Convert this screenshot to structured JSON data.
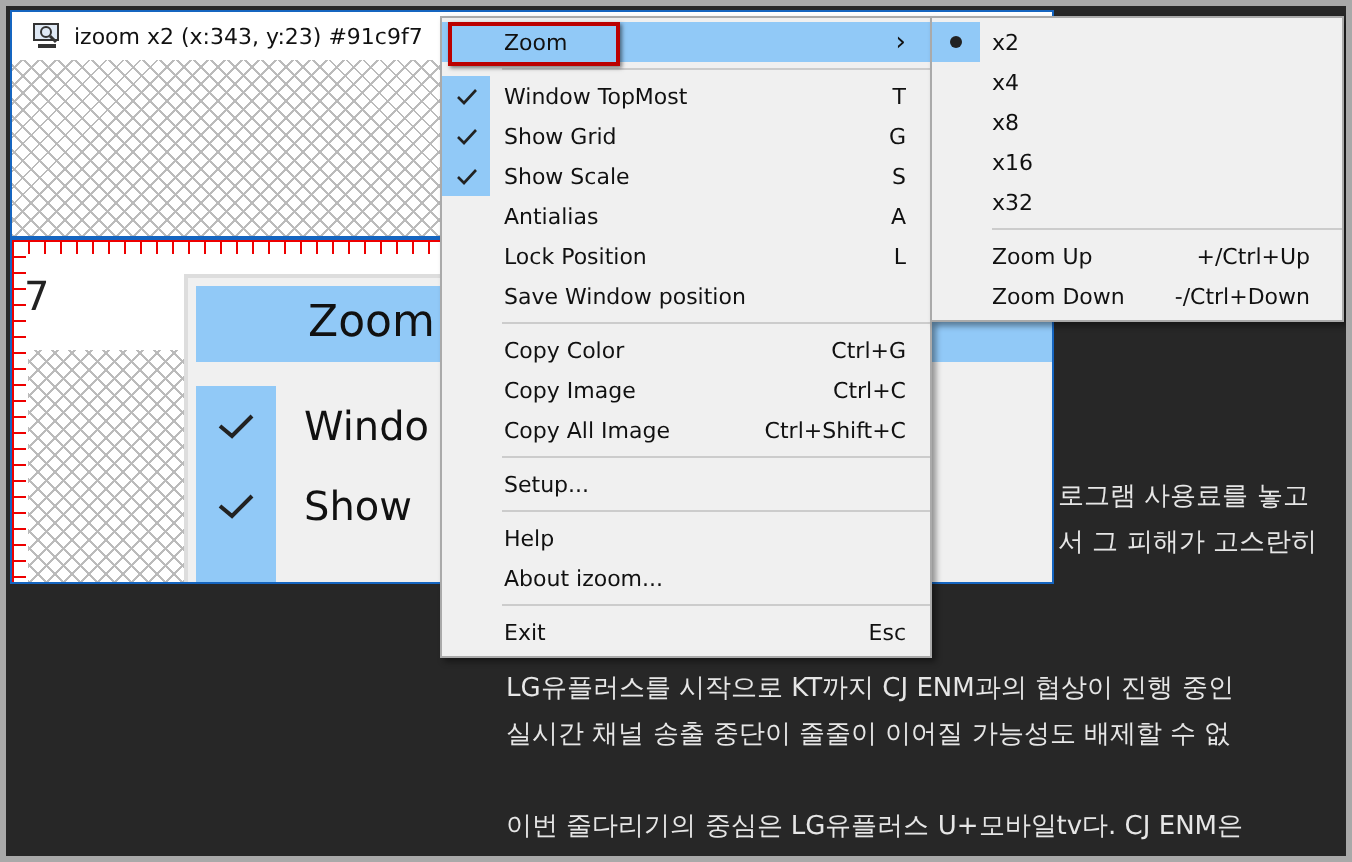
{
  "izoom_window": {
    "title": "izoom x2 (x:343, y:23) #91c9f7",
    "magnified_view": {
      "ruler_label": "7",
      "menu_header": "Zoom",
      "items": [
        {
          "label": "Windo",
          "checked": true
        },
        {
          "label": "Show",
          "checked": true
        }
      ]
    }
  },
  "article": {
    "lines_top": [
      "로그램 사용료를 놓고",
      "서 그 피해가 고스란히"
    ],
    "lines_bottom": [
      "LG유플러스를 시작으로 KT까지 CJ ENM과의 협상이 진행 중인",
      "실시간 채널 송출 중단이 줄줄이 이어질 가능성도 배제할 수 없"
    ],
    "paragraph_2": "이번 줄다리기의 중심은 LG유플러스 U+모바일tv다. CJ ENM은"
  },
  "context_menu": {
    "groups": [
      [
        {
          "kind": "submenu",
          "label": "Zoom",
          "arrow": "›",
          "selected": true,
          "annotated": true,
          "checked": false
        }
      ],
      [
        {
          "kind": "item",
          "label": "Window TopMost",
          "shortcut": "T",
          "checked": true,
          "selected": false,
          "annotated": false
        },
        {
          "kind": "item",
          "label": "Show Grid",
          "shortcut": "G",
          "checked": true,
          "selected": false,
          "annotated": false
        },
        {
          "kind": "item",
          "label": "Show Scale",
          "shortcut": "S",
          "checked": true,
          "selected": false,
          "annotated": false
        },
        {
          "kind": "item",
          "label": "Antialias",
          "shortcut": "A",
          "checked": false,
          "selected": false,
          "annotated": false
        },
        {
          "kind": "item",
          "label": "Lock Position",
          "shortcut": "L",
          "checked": false,
          "selected": false,
          "annotated": false
        },
        {
          "kind": "item",
          "label": "Save Window position",
          "checked": false,
          "selected": false,
          "annotated": false
        }
      ],
      [
        {
          "kind": "item",
          "label": "Copy Color",
          "shortcut": "Ctrl+G",
          "checked": false,
          "selected": false,
          "annotated": false
        },
        {
          "kind": "item",
          "label": "Copy Image",
          "shortcut": "Ctrl+C",
          "checked": false,
          "selected": false,
          "annotated": false
        },
        {
          "kind": "item",
          "label": "Copy All Image",
          "shortcut": "Ctrl+Shift+C",
          "checked": false,
          "selected": false,
          "annotated": false
        }
      ],
      [
        {
          "kind": "item",
          "label": "Setup...",
          "checked": false,
          "selected": false,
          "annotated": false
        }
      ],
      [
        {
          "kind": "item",
          "label": "Help",
          "checked": false,
          "selected": false,
          "annotated": false
        },
        {
          "kind": "item",
          "label": "About izoom...",
          "checked": false,
          "selected": false,
          "annotated": false
        }
      ],
      [
        {
          "kind": "item",
          "label": "Exit",
          "shortcut": "Esc",
          "checked": false,
          "selected": false,
          "annotated": false
        }
      ]
    ]
  },
  "zoom_submenu": {
    "groups": [
      [
        {
          "kind": "radio",
          "label": "x2",
          "selected": true
        },
        {
          "kind": "radio",
          "label": "x4",
          "selected": false
        },
        {
          "kind": "radio",
          "label": "x8",
          "selected": false
        },
        {
          "kind": "radio",
          "label": "x16",
          "selected": false
        },
        {
          "kind": "radio",
          "label": "x32",
          "selected": false
        }
      ],
      [
        {
          "kind": "command",
          "label": "Zoom Up",
          "shortcut": "+/Ctrl+Up",
          "selected": false
        },
        {
          "kind": "command",
          "label": "Zoom Down",
          "shortcut": "-/Ctrl+Down",
          "selected": false
        }
      ]
    ]
  }
}
